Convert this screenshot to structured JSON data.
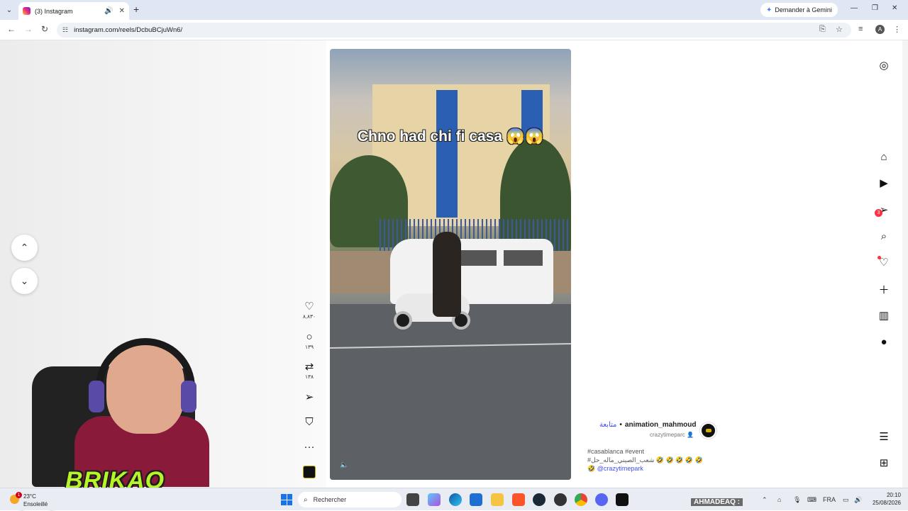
{
  "browser": {
    "tab_title": "(3) Instagram",
    "new_tab": "+",
    "gemini_label": "Demander à Gemini",
    "url": "instagram.com/reels/DcbuBCjuWn6/",
    "profile_initial": "A"
  },
  "reel": {
    "caption_text": "Chno had chi fi casa 😱😱",
    "likes": "٨,٨٣٠",
    "comments": "١٣٩",
    "reposts": "١٣٨",
    "author": "animation_mahmoud",
    "separator": "•",
    "follow_label": "متابعة",
    "audio": "crazytimeparc",
    "hashtags": "#casablanca #event",
    "desc_line2": "#شعب_الصيني_ماله_حل 🤣 🤣 🤣 🤣 🤣",
    "mention_prefix": "🤣",
    "mention": "@crazytimepark"
  },
  "sidebar": {
    "notifications_badge": "3"
  },
  "overlay": {
    "brand": "BRIKAO"
  },
  "taskbar": {
    "temperature": "23°C",
    "condition": "Ensoleillé",
    "weather_badge": "1",
    "search_placeholder": "Rechercher",
    "streamer_label": "AHMADEAQ :",
    "language": "FRA",
    "time": "20:10",
    "date": "25/08/2026"
  },
  "colors": {
    "link": "#4150f7",
    "notification_red": "#ff3040",
    "brand_green": "#b7f52a"
  }
}
